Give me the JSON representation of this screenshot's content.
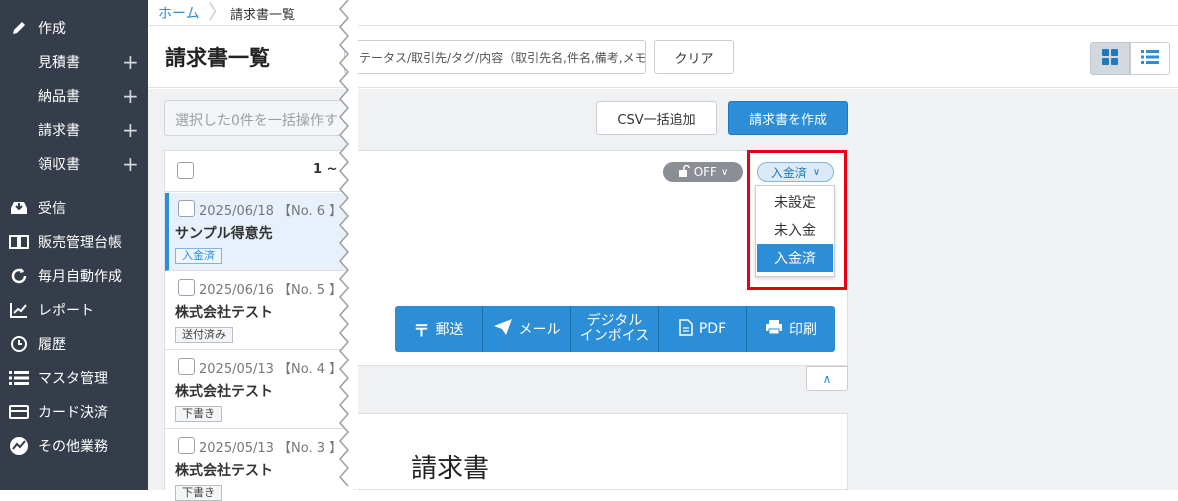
{
  "sidebar": {
    "create": "作成",
    "estimate": "見積書",
    "delivery": "納品書",
    "invoice": "請求書",
    "receipt": "領収書",
    "receive": "受信",
    "sales_ledger": "販売管理台帳",
    "monthly_auto": "毎月自動作成",
    "report": "レポート",
    "history": "履歴",
    "master": "マスタ管理",
    "card_payment": "カード決済",
    "other": "その他業務",
    "plus": "+"
  },
  "breadcrumb": {
    "home": "ホーム",
    "current": "請求書一覧"
  },
  "header": {
    "title": "請求書一覧",
    "search_placeholder": "ステータス/取引先/タグ/内容（取引先名,件名,備考,メモ）",
    "clear_label": "クリア"
  },
  "toolbar": {
    "bulk_placeholder": "選択した0件を一括操作す",
    "csv_label": "CSV一括追加",
    "create_label": "請求書を作成"
  },
  "list": {
    "count_label": "1 ~",
    "items": [
      {
        "date": "2025/06/18 【No. 6 】",
        "name": "サンプル得意先",
        "status": "入金済"
      },
      {
        "date": "2025/06/16 【No. 5 】",
        "name": "株式会社テスト",
        "status": "送付済み"
      },
      {
        "date": "2025/05/13 【No. 4 】",
        "name": "株式会社テスト",
        "status": "下書き"
      },
      {
        "date": "2025/05/13 【No. 3 】",
        "name": "株式会社テスト",
        "status": "下書き"
      }
    ]
  },
  "detail": {
    "lock_label": "OFF",
    "status_value": "入金済",
    "status_options": [
      "未設定",
      "未入金",
      "入金済"
    ],
    "selected_option": "入金済",
    "actions": {
      "mail": "郵送",
      "email": "メール",
      "digital_l1": "デジタル",
      "digital_l2": "インボイス",
      "pdf": "PDF",
      "print": "印刷"
    },
    "doc_title": "請求書"
  },
  "colors": {
    "sidebar": "#353c4a",
    "accent": "#2b8ed7",
    "highlight": "#e60012"
  }
}
